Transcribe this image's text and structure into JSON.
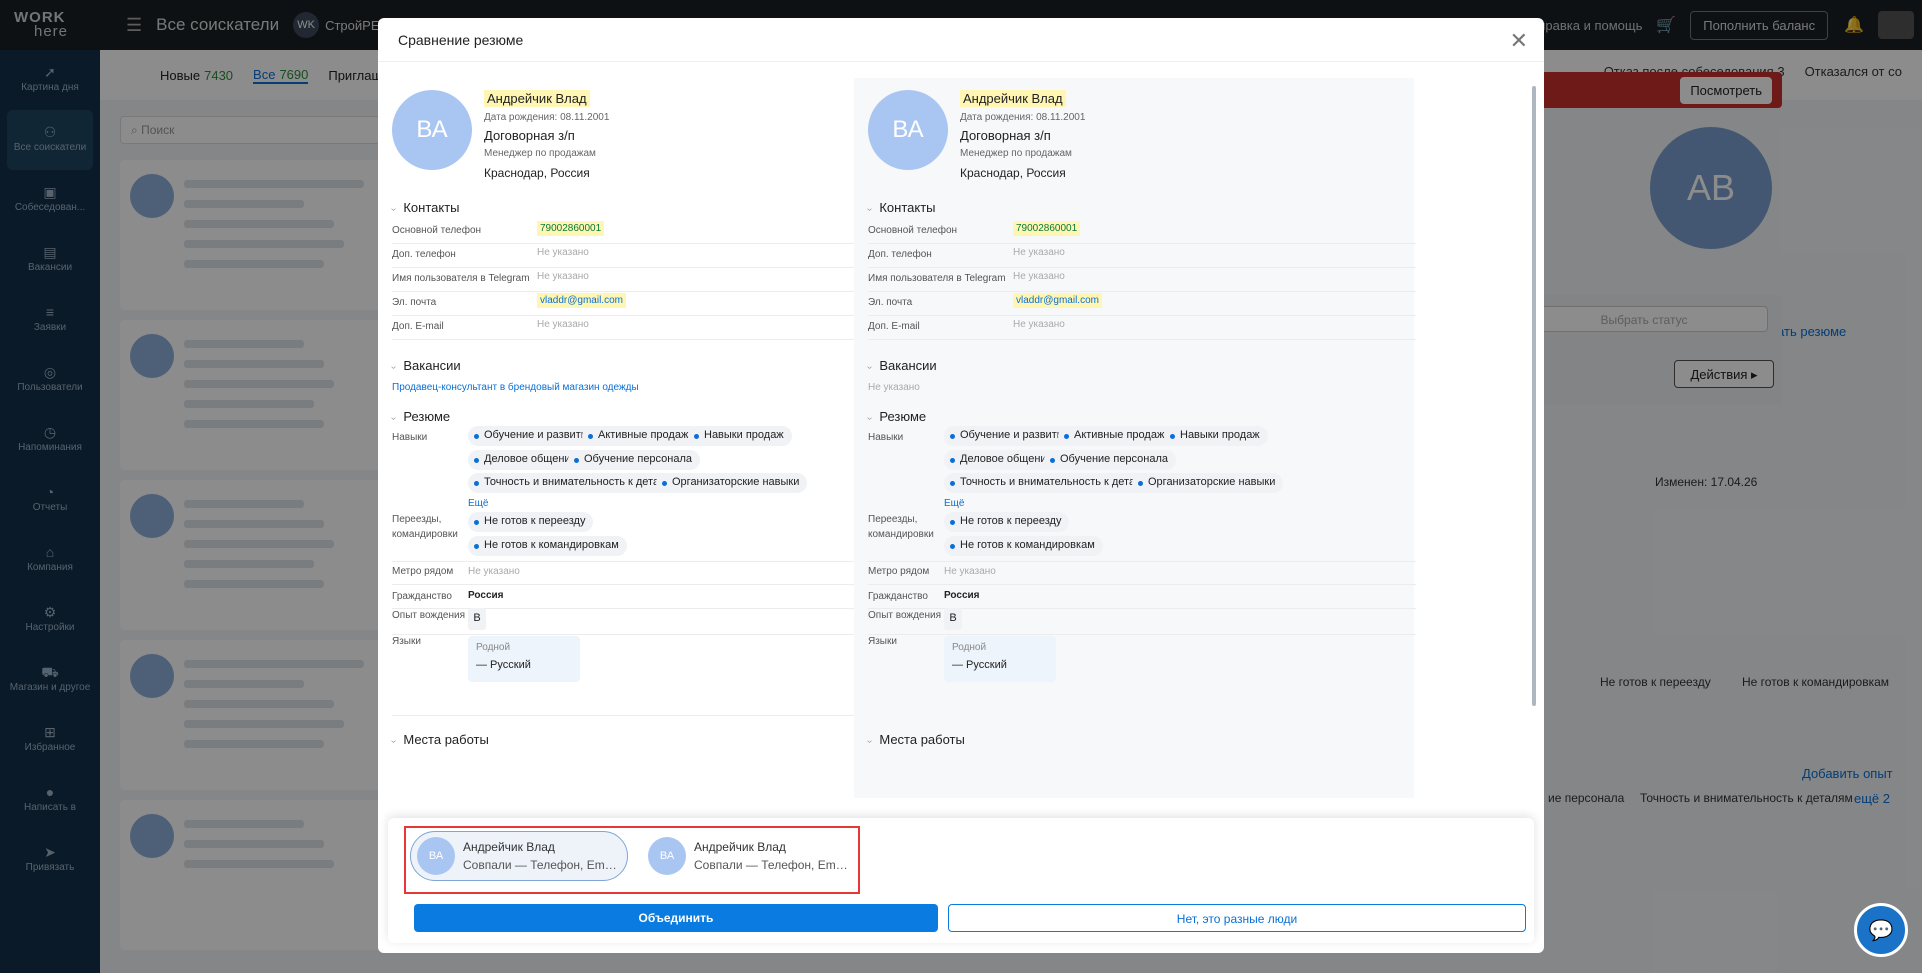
{
  "topbar": {
    "logo_top": "WORK",
    "logo_bottom": "here",
    "title": "Все соискатели",
    "company_initials": "WK",
    "company": "СтройРЕги",
    "help": "Справка и помощь",
    "balance_button": "Пополнить баланс"
  },
  "sidebar": {
    "items": [
      {
        "label": "Картина дня"
      },
      {
        "label": "Все соискатели"
      },
      {
        "label": "Собеседован..."
      },
      {
        "label": "Вакансии"
      },
      {
        "label": "Заявки"
      },
      {
        "label": "Пользователи"
      },
      {
        "label": "Напоминания"
      },
      {
        "label": "Отчеты"
      },
      {
        "label": "Компания"
      },
      {
        "label": "Настройки"
      },
      {
        "label": "Магазин и другое"
      },
      {
        "label": "Избранное"
      },
      {
        "label": "Написать в"
      },
      {
        "label": "Привязать"
      }
    ]
  },
  "background": {
    "tabs": [
      {
        "label": "Новые",
        "count": "7430"
      },
      {
        "label": "Все",
        "count": "7690"
      },
      {
        "label": "Приглаш",
        "count": ""
      }
    ],
    "tabs_right": [
      "Отказ после собеседования 3",
      "Отказался от со"
    ],
    "search_placeholder": "Поиск",
    "view_button": "Посмотреть",
    "big_avatar": "AB",
    "download": "Скачать резюме",
    "status_placeholder": "Выбрать статус",
    "changed": "Изменен: 17.04.26",
    "actions": "Действия",
    "relocation_tags": [
      "Не готов к переезду",
      "Не готов к командировкам"
    ],
    "add_experience": "Добавить опыт",
    "skills_tags": [
      "ие персонала",
      "Точность и внимательность к деталям"
    ],
    "more": "ещё 2"
  },
  "modal": {
    "title": "Сравнение резюме",
    "labels": {
      "contacts": "Контакты",
      "main_phone": "Основной телефон",
      "extra_phone": "Доп. телефон",
      "telegram": "Имя пользователя в Telegram",
      "email": "Эл. почта",
      "extra_email": "Доп. E-mail",
      "vacancies": "Вакансии",
      "resume": "Резюме",
      "skills": "Навыки",
      "more": "Ещё",
      "relocation": "Переезды, командировки",
      "metro": "Метро рядом",
      "citizenship": "Гражданство",
      "driving": "Опыт вождения",
      "languages": "Языки",
      "native": "Родной",
      "workplaces": "Места работы",
      "not_specified": "Не указано"
    },
    "columns": [
      {
        "initials": "ВА",
        "name": "Андрейчик Влад",
        "dob": "Дата рождения: 08.11.2001",
        "salary": "Договорная з/п",
        "position": "Менеджер по продажам",
        "city": "Краснодар, Россия",
        "phone": "79002860001",
        "email": "vladdr@gmail.com",
        "vacancy": "Продавец-консультант в брендовый магазин одежды",
        "skills": [
          "Обучение и развитие",
          "Активные продажи",
          "Навыки продаж",
          "Деловое общение",
          "Обучение персонала",
          "Точность и внимательность к деталям",
          "Организаторские навыки"
        ],
        "relocation": [
          "Не готов к переезду",
          "Не готов к командировкам"
        ],
        "citizenship": "Россия",
        "driving": "B",
        "language": "— Русский"
      },
      {
        "initials": "ВА",
        "name": "Андрейчик Влад",
        "dob": "Дата рождения: 08.11.2001",
        "salary": "Договорная з/п",
        "position": "Менеджер по продажам",
        "city": "Краснодар, Россия",
        "phone": "79002860001",
        "email": "vladdr@gmail.com",
        "vacancy": "Не указано",
        "skills": [
          "Обучение и развитие",
          "Активные продажи",
          "Навыки продаж",
          "Деловое общение",
          "Обучение персонала",
          "Точность и внимательность к деталям",
          "Организаторские навыки"
        ],
        "relocation": [
          "Не готов к переезду",
          "Не готов к командировкам"
        ],
        "citizenship": "Россия",
        "driving": "B",
        "language": "— Русский"
      }
    ],
    "merge": {
      "candidates": [
        {
          "initials": "ВА",
          "name": "Андрейчик Влад",
          "match": "Совпали — Телефон, Email, ..."
        },
        {
          "initials": "ВА",
          "name": "Андрейчик Влад",
          "match": "Совпали — Телефон, Email, ..."
        }
      ],
      "merge_button": "Объединить",
      "different_button": "Нет, это разные люди"
    }
  },
  "colors": {
    "accent": "#0a7be0",
    "highlight": "#fff6b3",
    "avatar": "#a9c6f2",
    "sidebar": "#15304a"
  }
}
